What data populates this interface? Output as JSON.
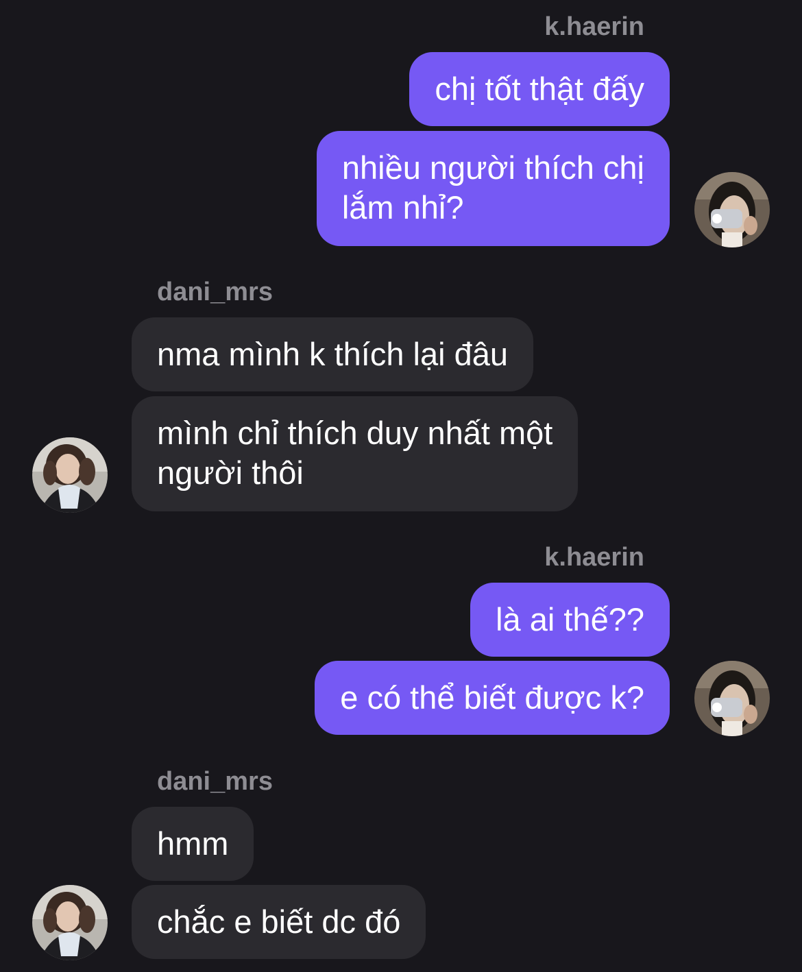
{
  "messages": [
    {
      "sender": "k.haerin",
      "bubbles": [
        "chị tốt thật đấy",
        "nhiều người thích chị\nlắm nhỉ?"
      ]
    },
    {
      "sender": "dani_mrs",
      "bubbles": [
        "nma mình k thích lại đâu",
        "mình chỉ thích duy nhất một\nngười thôi"
      ]
    },
    {
      "sender": "k.haerin",
      "bubbles": [
        "là ai thế??",
        "e có thể biết được k?"
      ]
    },
    {
      "sender": "dani_mrs",
      "bubbles": [
        "hmm",
        "chắc e biết dc đó"
      ]
    }
  ],
  "colors": {
    "background": "#18171c",
    "outgoing_bubble": "#7659f4",
    "incoming_bubble": "#2b2a2f",
    "sender_name": "#8e8d93"
  },
  "icons": {
    "haerin_avatar": "avatar-photo",
    "dani_avatar": "avatar-photo"
  }
}
